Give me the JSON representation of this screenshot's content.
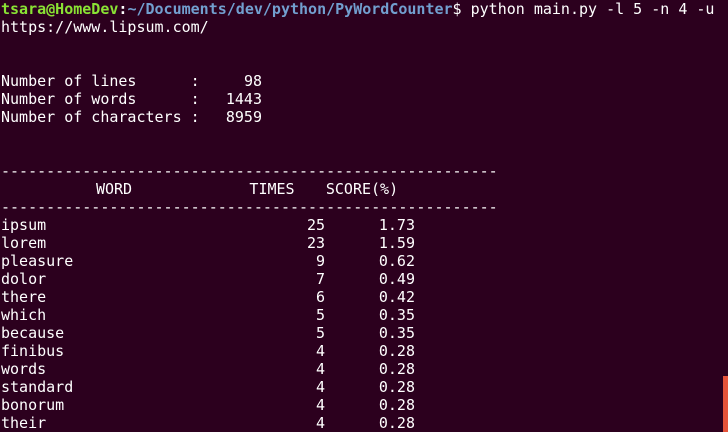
{
  "prompt": {
    "user_host": "tsara@HomeDev",
    "separator": ":",
    "path": "~/Documents/dev/python/PyWordCounter",
    "symbol": "$",
    "command": " python main.py -l 5 -n 4 -u",
    "command_wrap": "https://www.lipsum.com/"
  },
  "stats": [
    {
      "label": "Number of lines      :",
      "value": "98"
    },
    {
      "label": "Number of words      :",
      "value": "1443"
    },
    {
      "label": "Number of characters :",
      "value": "8959"
    }
  ],
  "table": {
    "separator": "-------------------------------------------------------",
    "headers": {
      "word": "WORD",
      "times": "TIMES",
      "score": "SCORE(%)"
    },
    "rows": [
      {
        "word": "ipsum",
        "times": "25",
        "score": "1.73"
      },
      {
        "word": "lorem",
        "times": "23",
        "score": "1.59"
      },
      {
        "word": "pleasure",
        "times": "9",
        "score": "0.62"
      },
      {
        "word": "dolor",
        "times": "7",
        "score": "0.49"
      },
      {
        "word": "there",
        "times": "6",
        "score": "0.42"
      },
      {
        "word": "which",
        "times": "5",
        "score": "0.35"
      },
      {
        "word": "because",
        "times": "5",
        "score": "0.35"
      },
      {
        "word": "finibus",
        "times": "4",
        "score": "0.28"
      },
      {
        "word": "words",
        "times": "4",
        "score": "0.28"
      },
      {
        "word": "standard",
        "times": "4",
        "score": "0.28"
      },
      {
        "word": "bonorum",
        "times": "4",
        "score": "0.28"
      },
      {
        "word": "their",
        "times": "4",
        "score": "0.28"
      }
    ]
  },
  "colors": {
    "background": "#2c001e",
    "prompt_user": "#8ae234",
    "prompt_path": "#729fcf",
    "text": "#ffffff",
    "scroll_thumb": "#e5533a"
  }
}
